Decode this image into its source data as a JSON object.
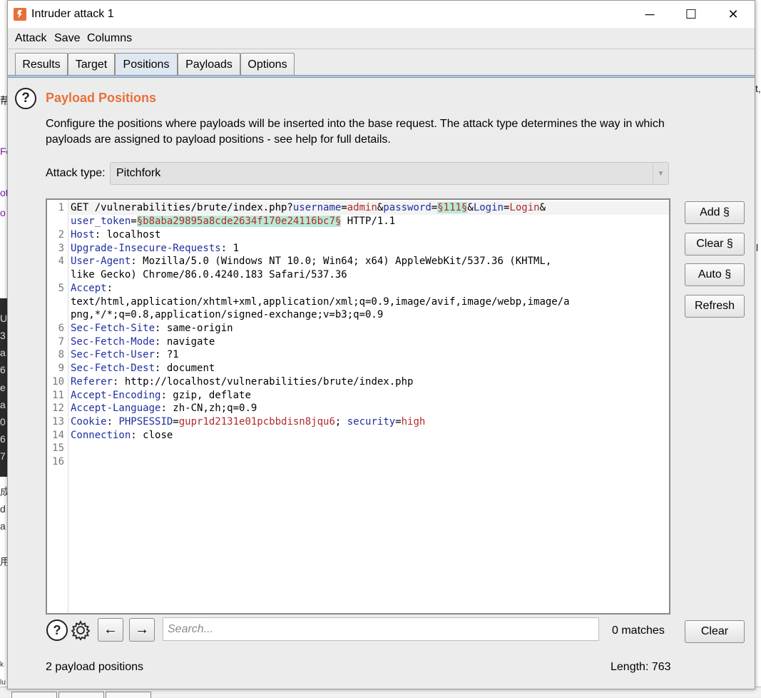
{
  "window": {
    "title": "Intruder attack 1",
    "minimize": "─",
    "maximize": "☐",
    "close": "✕"
  },
  "menu": [
    "Attack",
    "Save",
    "Columns"
  ],
  "tabs": [
    "Results",
    "Target",
    "Positions",
    "Payloads",
    "Options"
  ],
  "active_tab": "Positions",
  "section": {
    "title": "Payload Positions",
    "description_line1": "Configure the positions where payloads will be inserted into the base request. The attack type determines the way in which",
    "description_line2": "payloads are assigned to payload positions - see help for full details."
  },
  "attack_type": {
    "label": "Attack type:",
    "value": "Pitchfork"
  },
  "request": {
    "line_numbers": [
      "1",
      "2",
      "3",
      "4",
      "5",
      "6",
      "7",
      "8",
      "9",
      "10",
      "11",
      "12",
      "13",
      "14",
      "15",
      "16"
    ],
    "l1_method": "GET /vulnerabilities/brute/index.php?",
    "l1_p1": "username",
    "l1_eq1": "=",
    "l1_v1": "admin",
    "l1_amp1": "&",
    "l1_p2": "password",
    "l1_eq2": "=",
    "l1_pos1": "§111§",
    "l1_amp2": "&",
    "l1_p3": "Login",
    "l1_eq3": "=",
    "l1_v3": "Login",
    "l1_amp3": "&",
    "l1b_p4": "user_token",
    "l1b_eq4": "=",
    "l1b_pos2": "§b8aba29895a8cde2634f170e24116bc7§",
    "l1b_proto": " HTTP/1.1",
    "l2_name": "Host",
    "l2_value": ": localhost",
    "l3_name": "Upgrade-Insecure-Requests",
    "l3_value": ": 1",
    "l4_name": "User-Agent",
    "l4_value": ": Mozilla/5.0 (Windows NT 10.0; Win64; x64) AppleWebKit/537.36 (KHTML,",
    "l4_cont": "like Gecko) Chrome/86.0.4240.183 Safari/537.36",
    "l5_name": "Accept",
    "l5_colon": ":",
    "l5_cont1": "text/html,application/xhtml+xml,application/xml;q=0.9,image/avif,image/webp,image/a",
    "l5_cont2": "png,*/*;q=0.8,application/signed-exchange;v=b3;q=0.9",
    "l6_name": "Sec-Fetch-Site",
    "l6_value": ": same-origin",
    "l7_name": "Sec-Fetch-Mode",
    "l7_value": ": navigate",
    "l8_name": "Sec-Fetch-User",
    "l8_value": ": ?1",
    "l9_name": "Sec-Fetch-Dest",
    "l9_value": ": document",
    "l10_name": "Referer",
    "l10_value": ": http://localhost/vulnerabilities/brute/index.php",
    "l11_name": "Accept-Encoding",
    "l11_value": ": gzip, deflate",
    "l12_name": "Accept-Language",
    "l12_value": ": zh-CN,zh;q=0.9",
    "l13_name": "Cookie",
    "l13_colon": ": ",
    "l13_c1": "PHPSESSID",
    "l13_eq1": "=",
    "l13_v1": "gupr1d2131e01pcbbdisn8jqu6",
    "l13_sep": "; ",
    "l13_c2": "security",
    "l13_eq2": "=",
    "l13_v2": "high",
    "l14_name": "Connection",
    "l14_value": ": close"
  },
  "side_buttons": {
    "add": "Add §",
    "clear": "Clear §",
    "auto": "Auto §",
    "refresh": "Refresh"
  },
  "search": {
    "placeholder": "Search...",
    "matches": "0 matches",
    "clear": "Clear",
    "back": "←",
    "forward": "→",
    "help": "?"
  },
  "status": {
    "positions": "2 payload positions",
    "length": "Length: 763"
  },
  "background_fragments": [
    "帮",
    "Fo",
    "ot",
    "o",
    "U",
    "3",
    "a",
    "6",
    "e",
    "a",
    "0",
    "6",
    "7",
    "成",
    "d",
    "a",
    "用",
    "k",
    "lu",
    "t,",
    "l"
  ]
}
